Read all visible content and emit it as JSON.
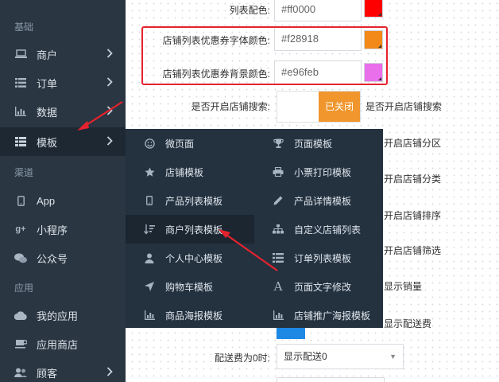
{
  "sidebar": {
    "sections": [
      {
        "label": "基础"
      },
      {
        "label": "渠道"
      },
      {
        "label": "应用"
      }
    ],
    "items": [
      {
        "label": "商户",
        "icon": "laptop-icon"
      },
      {
        "label": "订单",
        "icon": "list-icon"
      },
      {
        "label": "数据",
        "icon": "bar-chart-icon"
      },
      {
        "label": "模板",
        "icon": "grid-list-icon"
      },
      {
        "label": "App",
        "icon": "mobile-icon"
      },
      {
        "label": "小程序",
        "icon": "google-plus-icon"
      },
      {
        "label": "公众号",
        "icon": "wechat-icon"
      },
      {
        "label": "我的应用",
        "icon": "cloud-icon"
      },
      {
        "label": "应用商店",
        "icon": "coffee-icon"
      },
      {
        "label": "顾客",
        "icon": "users-icon"
      }
    ]
  },
  "form": {
    "list_color_label": "列表配色:",
    "list_color_value": "#ff0000",
    "list_color_swatch": "#ff0000",
    "coupon_font_label": "店铺列表优惠券字体颜色:",
    "coupon_font_value": "#f28918",
    "coupon_font_swatch": "#f28918",
    "coupon_bg_label": "店铺列表优惠券背景颜色:",
    "coupon_bg_value": "#e96feb",
    "coupon_bg_swatch": "#e96feb",
    "search_label": "是否开启店铺搜索:",
    "search_toggle": "已关闭",
    "search_text": "是否开启店铺搜索",
    "right_texts": [
      "开启店铺分区",
      "开启店铺分类",
      "开启店铺排序",
      "开启店铺筛选",
      "显示销量",
      "显示配送费"
    ],
    "delivery_label": "配送费为0时:",
    "delivery_select": "显示配送0"
  },
  "menu": {
    "left": [
      {
        "label": "微页面",
        "icon": "smile-icon"
      },
      {
        "label": "店铺模板",
        "icon": "star-icon"
      },
      {
        "label": "产品列表模板",
        "icon": "mobile-icon"
      },
      {
        "label": "商户列表模板",
        "icon": "sort-icon"
      },
      {
        "label": "个人中心模板",
        "icon": "user-icon"
      },
      {
        "label": "购物车模板",
        "icon": "location-arrow-icon"
      },
      {
        "label": "商品海报模板",
        "icon": "bar-chart-icon"
      }
    ],
    "right": [
      {
        "label": "页面模板",
        "icon": "trophy-icon"
      },
      {
        "label": "小票打印模板",
        "icon": "print-icon"
      },
      {
        "label": "产品详情模板",
        "icon": "pencil-icon"
      },
      {
        "label": "自定义店铺列表",
        "icon": "sitemap-icon"
      },
      {
        "label": "订单列表模板",
        "icon": "list-icon"
      },
      {
        "label": "页面文字修改",
        "icon": "font-icon"
      },
      {
        "label": "店铺推广海报模板",
        "icon": "bar-chart-icon"
      }
    ]
  },
  "colors": {
    "sidebar_bg": "#2a3642",
    "menu_bg": "#243240",
    "accent_orange": "#f0962c",
    "annotation_red": "#e5232e"
  }
}
